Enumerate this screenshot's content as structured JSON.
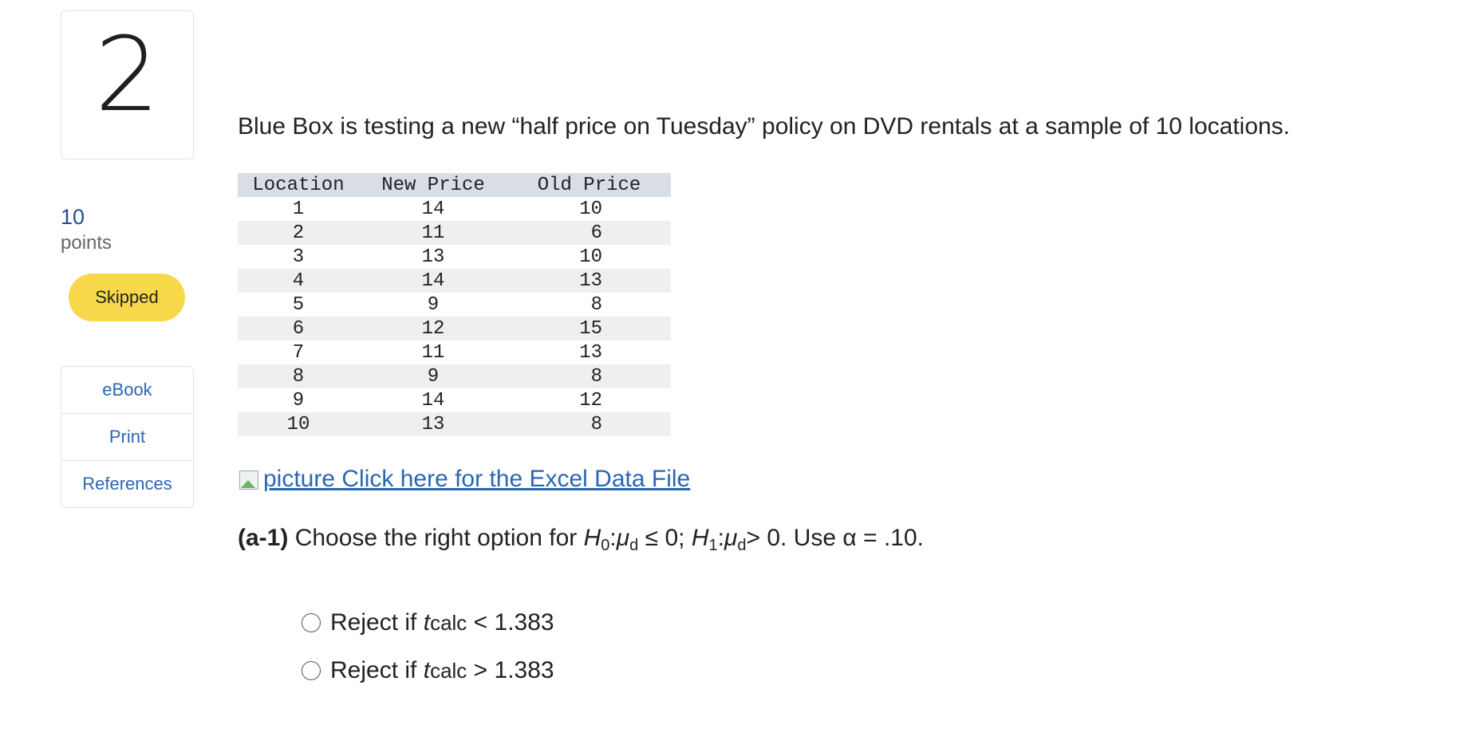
{
  "sidebar": {
    "question_number": "2",
    "points_value": "10",
    "points_label": "points",
    "status_badge": "Skipped",
    "links": [
      "eBook",
      "Print",
      "References"
    ]
  },
  "question": {
    "text": "Blue Box is testing a new “half price on Tuesday” policy on DVD rentals at a sample of 10 locations."
  },
  "table": {
    "headers": [
      "Location",
      "New Price",
      "Old Price"
    ],
    "rows": [
      [
        "1",
        "14",
        "10"
      ],
      [
        "2",
        "11",
        "6"
      ],
      [
        "3",
        "13",
        "10"
      ],
      [
        "4",
        "14",
        "13"
      ],
      [
        "5",
        "9",
        "8"
      ],
      [
        "6",
        "12",
        "15"
      ],
      [
        "7",
        "11",
        "13"
      ],
      [
        "8",
        "9",
        "8"
      ],
      [
        "9",
        "14",
        "12"
      ],
      [
        "10",
        "13",
        "8"
      ]
    ]
  },
  "excel_link": {
    "alt": "picture",
    "text": "Click here for the Excel Data File"
  },
  "part_a1": {
    "label": "(a-1)",
    "prompt": "Choose the right option for",
    "h0": "H",
    "h0_sub": "0",
    "mu": "μ",
    "mu_sub": "d",
    "h0_rel": "≤ 0;",
    "h1": "H",
    "h1_sub": "1",
    "h1_rel": "> 0. Use α = .10."
  },
  "options": [
    {
      "prefix": "Reject if",
      "t": "t",
      "t_sub": "calc",
      "cond": "< 1.383"
    },
    {
      "prefix": "Reject if",
      "t": "t",
      "t_sub": "calc",
      "cond": "> 1.383"
    }
  ]
}
